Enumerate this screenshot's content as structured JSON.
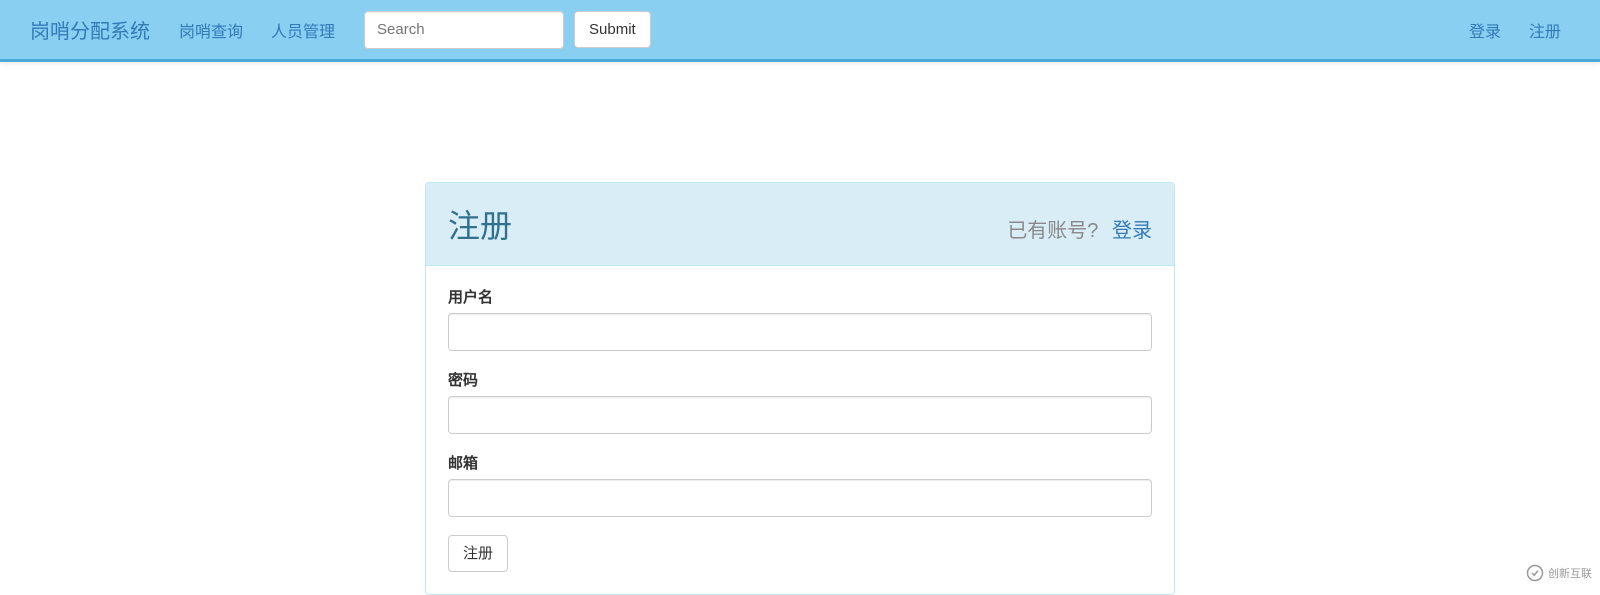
{
  "navbar": {
    "brand": "岗哨分配系统",
    "links": [
      "岗哨查询",
      "人员管理"
    ],
    "search_placeholder": "Search",
    "submit_label": "Submit",
    "right_links": [
      "登录",
      "注册"
    ]
  },
  "panel": {
    "title": "注册",
    "sub_text": "已有账号?",
    "sub_link": "登录"
  },
  "form": {
    "username_label": "用户名",
    "password_label": "密码",
    "email_label": "邮箱",
    "submit_label": "注册"
  },
  "watermark": {
    "text": "创新互联"
  }
}
